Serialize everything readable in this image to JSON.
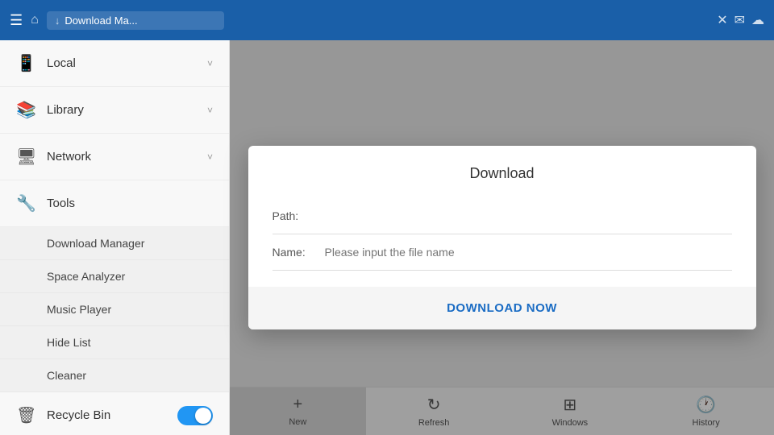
{
  "header": {
    "menu_label": "☰",
    "home_label": "⌂",
    "breadcrumb_arrow": "↓",
    "breadcrumb_text": "Download Ma...",
    "close_icon": "✕",
    "action_icons": [
      "✉",
      "☁"
    ]
  },
  "sidebar": {
    "items": [
      {
        "id": "local",
        "label": "Local",
        "icon": "📱",
        "has_chevron": true
      },
      {
        "id": "library",
        "label": "Library",
        "icon": "📚",
        "has_chevron": true
      },
      {
        "id": "network",
        "label": "Network",
        "icon": "🖥",
        "has_chevron": true
      },
      {
        "id": "tools",
        "label": "Tools",
        "icon": "🔧",
        "has_chevron": false
      }
    ],
    "sub_items": [
      {
        "id": "download-manager",
        "label": "Download Manager"
      },
      {
        "id": "space-analyzer",
        "label": "Space Analyzer"
      },
      {
        "id": "music-player",
        "label": "Music Player"
      },
      {
        "id": "hide-list",
        "label": "Hide List"
      },
      {
        "id": "cleaner",
        "label": "Cleaner"
      }
    ],
    "recycle_bin": {
      "label": "Recycle Bin",
      "icon": "🗑"
    }
  },
  "toolbar": {
    "items": [
      {
        "id": "new",
        "label": "New",
        "icon": "+"
      },
      {
        "id": "refresh",
        "label": "Refresh",
        "icon": "↻"
      },
      {
        "id": "windows",
        "label": "Windows",
        "icon": "⊞"
      },
      {
        "id": "history",
        "label": "History",
        "icon": "🕐"
      }
    ]
  },
  "modal": {
    "title": "Download",
    "path_label": "Path:",
    "name_label": "Name:",
    "name_placeholder": "Please input the file name",
    "download_button": "DOWNLOAD NOW"
  }
}
